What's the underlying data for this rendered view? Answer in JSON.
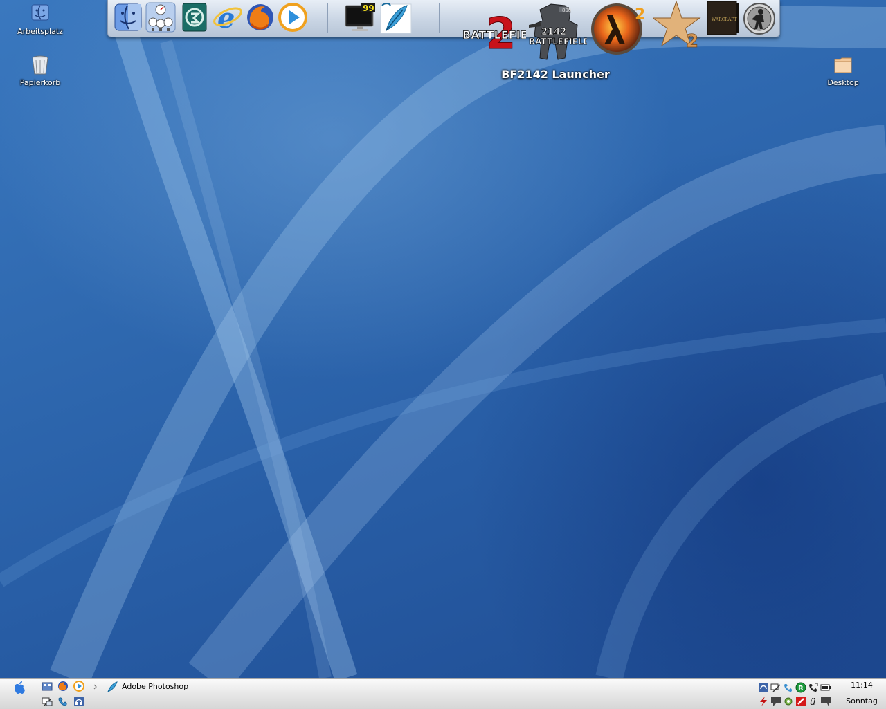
{
  "desktop": {
    "icons": [
      {
        "label": "Arbeitsplatz",
        "icon": "computer-icon"
      },
      {
        "label": "Papierkorb",
        "icon": "trash-icon"
      },
      {
        "label": "Desktop",
        "icon": "folder-icon"
      }
    ]
  },
  "dock": {
    "tooltip": "BF2142 Launcher",
    "items": [
      {
        "name": "finder",
        "icon": "finder-icon"
      },
      {
        "name": "system-monitor",
        "icon": "gauges-icon"
      },
      {
        "name": "3ds-max",
        "icon": "3dsmax-icon"
      },
      {
        "name": "internet-explorer",
        "icon": "ie-icon"
      },
      {
        "name": "firefox",
        "icon": "firefox-icon"
      },
      {
        "name": "media-player",
        "icon": "play-icon"
      },
      {
        "name": "display-monitor",
        "icon": "monitor-icon",
        "badge": "99"
      },
      {
        "name": "photoshop",
        "icon": "feather-icon"
      },
      {
        "name": "battlefield-2",
        "icon": "battlefield2-icon",
        "text": "BATTLEFIELD"
      },
      {
        "name": "battlefield-2142",
        "icon": "battlefield2142-icon",
        "text1": "2142",
        "text2": "BATTLEFIELD",
        "tag": "808"
      },
      {
        "name": "half-life-2",
        "icon": "halflife2-icon",
        "digit": "2"
      },
      {
        "name": "starcraft-2",
        "icon": "star-icon",
        "digit": "2"
      },
      {
        "name": "world-of-warcraft",
        "icon": "warcraft-box-icon",
        "text": "WARCRAFT"
      },
      {
        "name": "counter-strike",
        "icon": "counterstrike-icon"
      }
    ]
  },
  "taskbar": {
    "start_icon": "apple-icon",
    "quicklaunch": [
      {
        "name": "show-desktop",
        "icon": "show-desktop-icon"
      },
      {
        "name": "firefox",
        "icon": "firefox-icon"
      },
      {
        "name": "media-player",
        "icon": "play-icon"
      },
      {
        "name": "more",
        "icon": "chevron-right-icon"
      },
      {
        "name": "network",
        "icon": "network-icon"
      },
      {
        "name": "phone",
        "icon": "phone-icon"
      },
      {
        "name": "headset",
        "icon": "headset-icon"
      }
    ],
    "task": {
      "label": "Adobe Photoshop",
      "icon": "feather-icon"
    },
    "tray_icons": [
      "headset-icon",
      "network-icon",
      "phone-icon",
      "r-icon",
      "call-icon",
      "battery-icon",
      "flash-icon",
      "chat-icon",
      "settings-icon",
      "antivirus-icon",
      "u-icon",
      "message-icon"
    ],
    "clock": {
      "time": "11:14",
      "day": "Sonntag"
    }
  },
  "colors": {
    "desktop_blue": "#2f69b0",
    "dock_bg": "#d0dbe8",
    "taskbar_bg": "#e7e7e7"
  }
}
